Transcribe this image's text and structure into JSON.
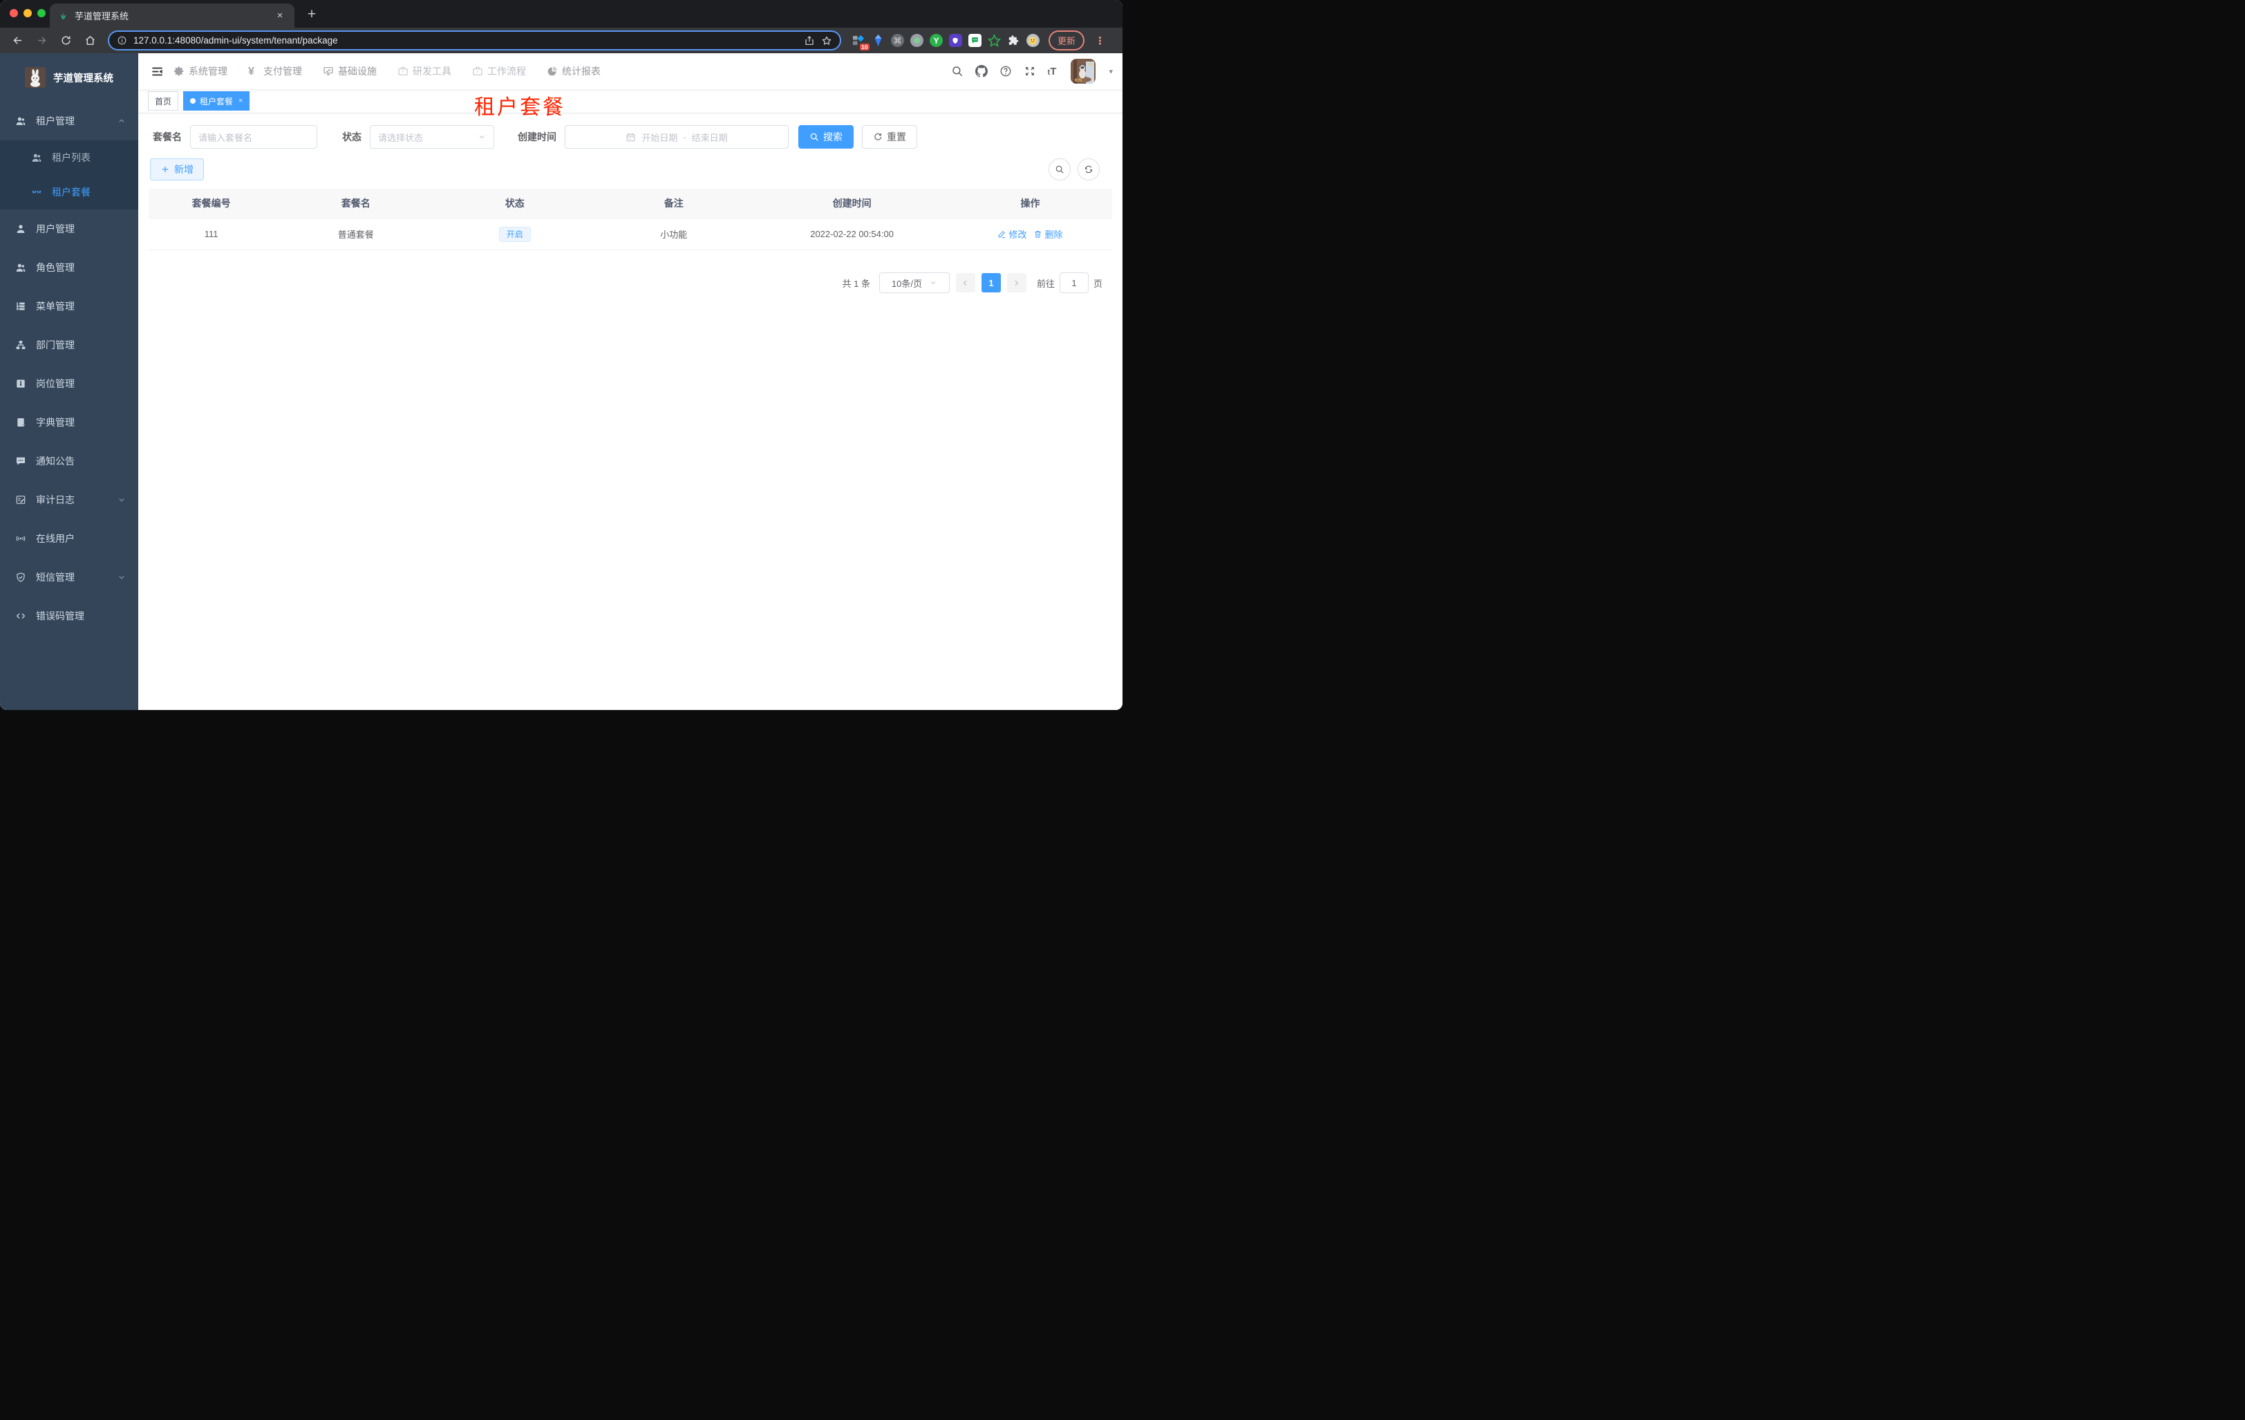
{
  "browser": {
    "tab_title": "芋道管理系统",
    "url": "127.0.0.1:48080/admin-ui/system/tenant/package",
    "extension_badge": "10",
    "update_label": "更新"
  },
  "app": {
    "logo_title": "芋道管理系统",
    "nav": {
      "items": [
        {
          "key": "system",
          "label": "系统管理",
          "icon": "gear",
          "muted": false
        },
        {
          "key": "payment",
          "label": "支付管理",
          "icon": "yen",
          "muted": false
        },
        {
          "key": "infra",
          "label": "基础设施",
          "icon": "monitor",
          "muted": false
        },
        {
          "key": "devtools",
          "label": "研发工具",
          "icon": "briefcase",
          "muted": true
        },
        {
          "key": "workflow",
          "label": "工作流程",
          "icon": "briefcase",
          "muted": true
        },
        {
          "key": "report",
          "label": "统计报表",
          "icon": "chart",
          "muted": false
        }
      ]
    },
    "sidebar": {
      "items": [
        {
          "key": "tenant",
          "label": "租户管理",
          "icon": "users",
          "type": "parent",
          "arrow": "up"
        },
        {
          "key": "tenant-list",
          "label": "租户列表",
          "icon": "users",
          "type": "child"
        },
        {
          "key": "tenant-package",
          "label": "租户套餐",
          "icon": "peoples",
          "type": "child",
          "active": true
        },
        {
          "key": "user",
          "label": "用户管理",
          "icon": "user",
          "type": "parent"
        },
        {
          "key": "role",
          "label": "角色管理",
          "icon": "users",
          "type": "parent"
        },
        {
          "key": "menu",
          "label": "菜单管理",
          "icon": "tree-table",
          "type": "parent"
        },
        {
          "key": "dept",
          "label": "部门管理",
          "icon": "tree",
          "type": "parent"
        },
        {
          "key": "post",
          "label": "岗位管理",
          "icon": "post",
          "type": "parent"
        },
        {
          "key": "dict",
          "label": "字典管理",
          "icon": "dict",
          "type": "parent"
        },
        {
          "key": "notice",
          "label": "通知公告",
          "icon": "message",
          "type": "parent"
        },
        {
          "key": "audit-log",
          "label": "审计日志",
          "icon": "log",
          "type": "parent",
          "arrow": "down"
        },
        {
          "key": "online-user",
          "label": "在线用户",
          "icon": "online",
          "type": "parent"
        },
        {
          "key": "sms",
          "label": "短信管理",
          "icon": "sms",
          "type": "parent",
          "arrow": "down"
        },
        {
          "key": "error-code",
          "label": "错误码管理",
          "icon": "code",
          "type": "parent"
        }
      ]
    },
    "tags": {
      "home": "首页",
      "active": "租户套餐"
    },
    "overlay_title": "租户套餐",
    "filters": {
      "name_label": "套餐名",
      "name_placeholder": "请输入套餐名",
      "status_label": "状态",
      "status_placeholder": "请选择状态",
      "time_label": "创建时间",
      "start_placeholder": "开始日期",
      "range_separator": "-",
      "end_placeholder": "结束日期",
      "search_label": "搜索",
      "reset_label": "重置"
    },
    "toolbar": {
      "add_label": "新增"
    },
    "table": {
      "columns": [
        "套餐编号",
        "套餐名",
        "状态",
        "备注",
        "创建时间",
        "操作"
      ],
      "col_widths": [
        "13%",
        "17%",
        "16%",
        "17%",
        "20%",
        "17%"
      ],
      "rows": [
        {
          "id": "111",
          "name": "普通套餐",
          "status": "开启",
          "remark": "小功能",
          "created": "2022-02-22 00:54:00"
        }
      ],
      "actions": {
        "edit": "修改",
        "delete": "删除"
      }
    },
    "pagination": {
      "total": "共 1 条",
      "page_size": "10条/页",
      "current_page": "1",
      "goto_prefix": "前往",
      "goto_value": "1",
      "goto_suffix": "页"
    }
  },
  "colors": {
    "accent_blue": "#409eff",
    "overlay_red": "#ff2400",
    "sidebar_bg": "#34455a",
    "submenu_bg": "#283a4d",
    "table_header_bg": "#f8f8f9",
    "badge_bg": "#ecf5ff",
    "update_red": "#f0938a"
  }
}
